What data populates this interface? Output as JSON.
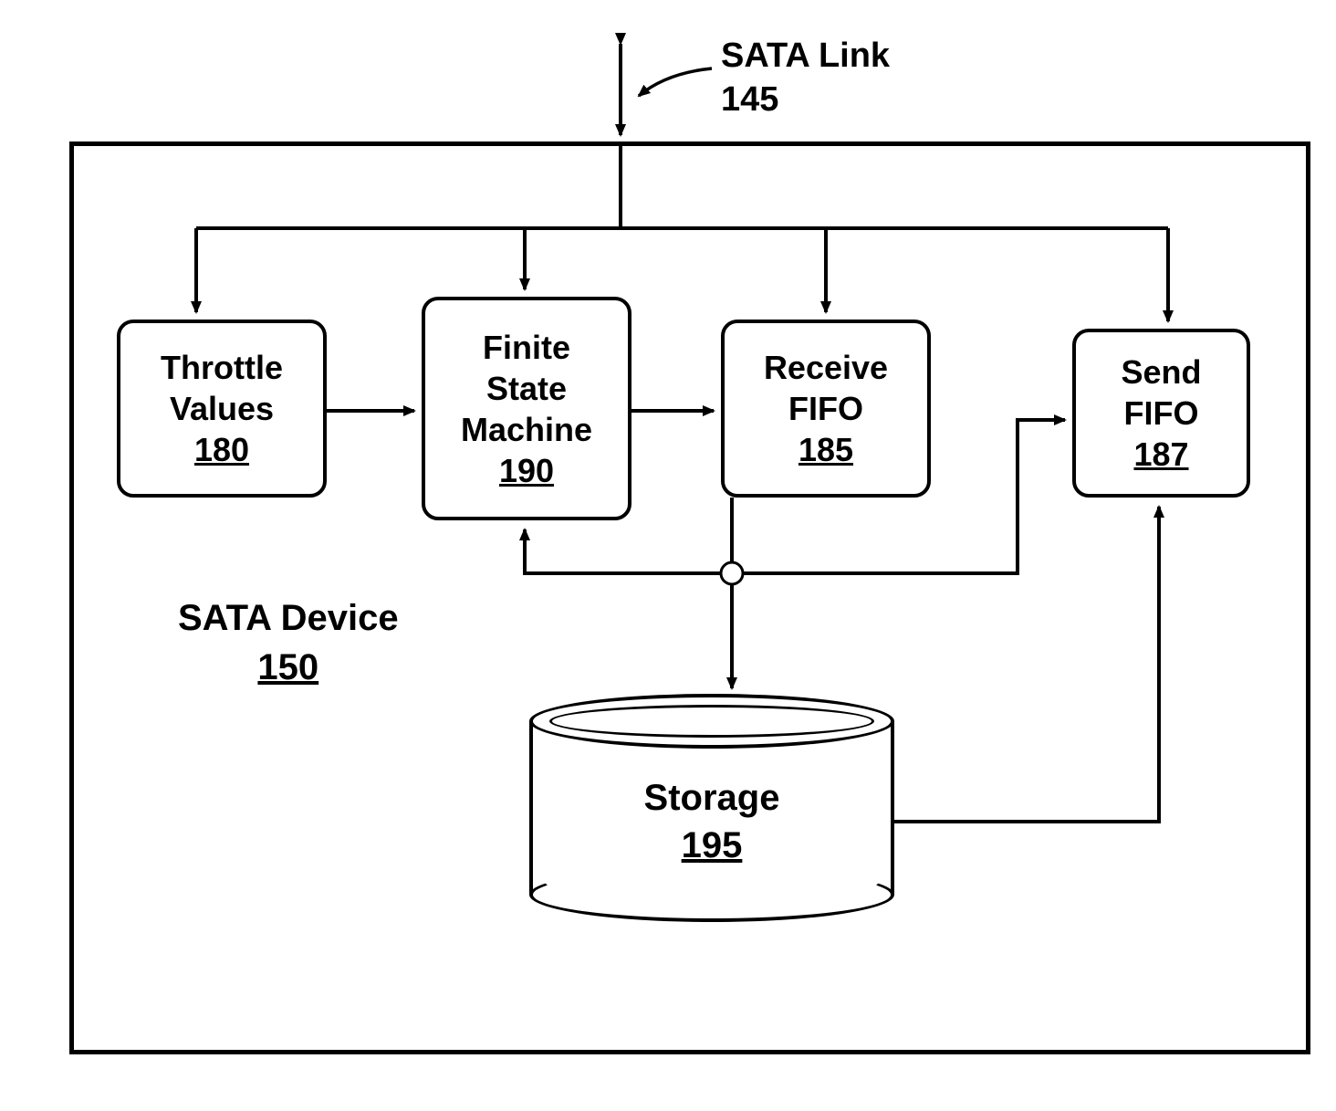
{
  "link": {
    "title": "SATA Link",
    "num": "145"
  },
  "device": {
    "title": "SATA Device",
    "num": "150"
  },
  "blocks": {
    "throttle": {
      "l1": "Throttle",
      "l2": "Values",
      "num": "180"
    },
    "fsm": {
      "l1": "Finite",
      "l2": "State",
      "l3": "Machine",
      "num": "190"
    },
    "rfifo": {
      "l1": "Receive",
      "l2": "FIFO",
      "num": "185"
    },
    "sfifo": {
      "l1": "Send",
      "l2": "FIFO",
      "num": "187"
    },
    "storage": {
      "l1": "Storage",
      "num": "195"
    }
  }
}
